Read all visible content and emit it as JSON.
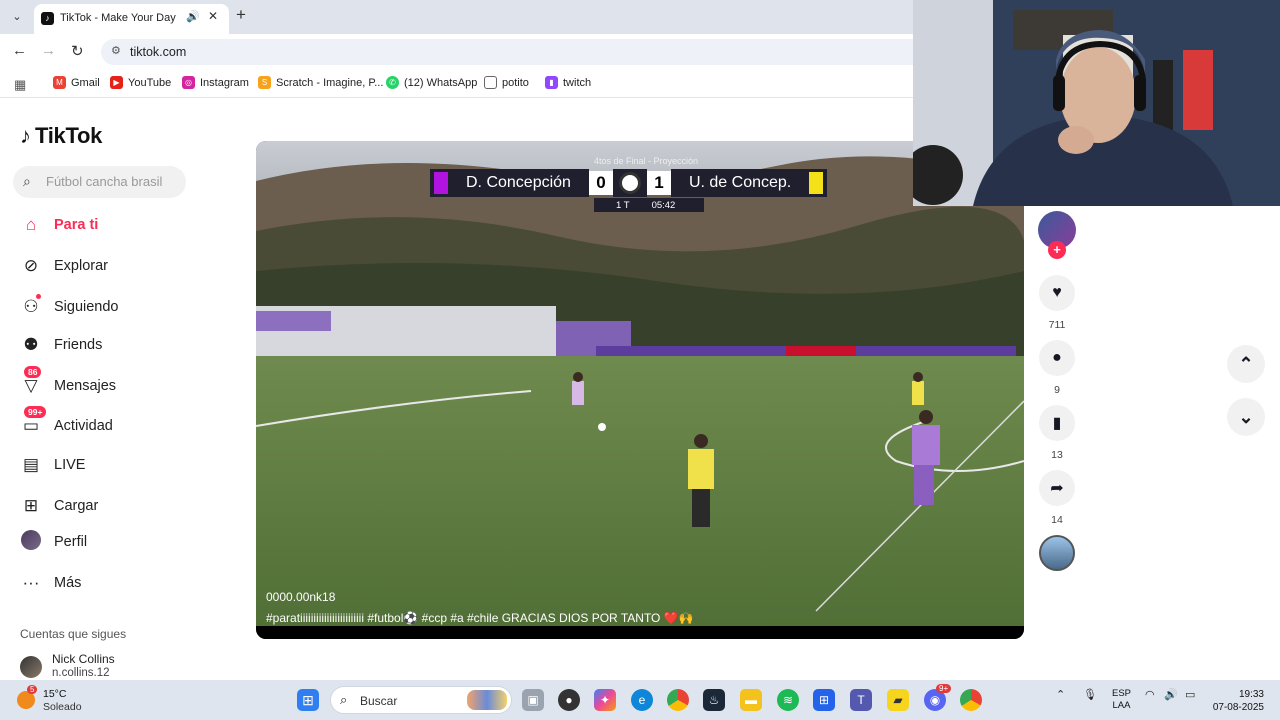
{
  "browser": {
    "tab_title": "TikTok - Make Your Day",
    "url": "tiktok.com",
    "bookmarks": [
      "Gmail",
      "YouTube",
      "Instagram",
      "Scratch - Imagine, P...",
      "(12) WhatsApp",
      "potito",
      "twitch"
    ]
  },
  "sidebar": {
    "logo": "TikTok",
    "search_placeholder": "Fútbol cancha brasil",
    "nav": [
      {
        "label": "Para ti",
        "icon": "home-icon"
      },
      {
        "label": "Explorar",
        "icon": "compass-icon"
      },
      {
        "label": "Siguiendo",
        "icon": "following-icon"
      },
      {
        "label": "Friends",
        "icon": "friends-icon"
      },
      {
        "label": "Mensajes",
        "icon": "messages-icon",
        "badge": "86"
      },
      {
        "label": "Actividad",
        "icon": "activity-icon",
        "badge": "99+"
      },
      {
        "label": "LIVE",
        "icon": "live-icon"
      },
      {
        "label": "Cargar",
        "icon": "upload-icon"
      },
      {
        "label": "Perfil",
        "icon": "profile-avatar"
      },
      {
        "label": "Más",
        "icon": "more-icon"
      }
    ],
    "following_title": "Cuentas que sigues",
    "following": [
      {
        "name": "Nick Collins",
        "handle": "n.collins.12"
      }
    ]
  },
  "video": {
    "scoreboard": {
      "round": "4tos de Final - Proyección",
      "home_team": "D. Concepción",
      "home_score": "0",
      "away_score": "1",
      "away_team": "U. de Concep.",
      "period": "1 T",
      "clock": "05:42",
      "home_color": "#b114e0",
      "away_color": "#f5e11a"
    },
    "author": "0000.00nk18",
    "caption": "#paratiiiiiiiiiiiiiiiiiiiiiiii  #futbol⚽  #ccp  #a #chile   GRACIAS DIOS POR TANTO  ❤️🙌"
  },
  "actions": {
    "likes": "711",
    "comments": "9",
    "saves": "13",
    "shares": "14"
  },
  "taskbar": {
    "weather_temp": "15°C",
    "weather_desc": "Soleado",
    "weather_badge": "5",
    "search_label": "Buscar",
    "lang_top": "ESP",
    "lang_bottom": "LAA",
    "time": "19:33",
    "date": "07-08-2025",
    "discord_badge": "9+"
  },
  "colors": {
    "accent": "#fe2c55"
  }
}
